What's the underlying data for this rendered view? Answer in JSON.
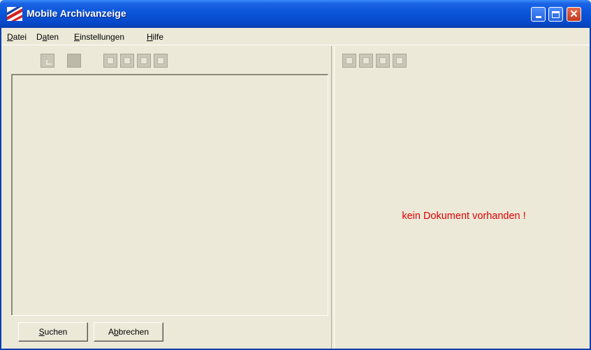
{
  "window": {
    "title": "Mobile Archivanzeige",
    "controls": [
      "minimize-icon",
      "maximize-icon",
      "close-icon"
    ]
  },
  "menu": {
    "items": [
      {
        "label": "Datei",
        "accel": "D"
      },
      {
        "label": "Daten",
        "accel": "a"
      },
      {
        "label": "Einstellungen",
        "accel": "E"
      },
      {
        "label": "Hilfe",
        "accel": "H"
      }
    ]
  },
  "left_toolbar": {
    "icons": [
      "tree-view-icon",
      "blank-icon",
      "first-page-icon",
      "previous-page-icon",
      "next-page-icon",
      "last-page-icon"
    ],
    "state": "disabled"
  },
  "right_toolbar": {
    "icons": [
      "first-page-icon",
      "previous-page-icon",
      "next-page-icon",
      "last-page-icon"
    ],
    "state": "disabled"
  },
  "buttons": {
    "search": "Suchen",
    "cancel": "Abbrechen"
  },
  "viewer": {
    "message": "kein Dokument vorhanden !",
    "message_color": "#e00000"
  },
  "colors": {
    "titlebar": "#0a55d9",
    "background": "#ece9d8"
  }
}
